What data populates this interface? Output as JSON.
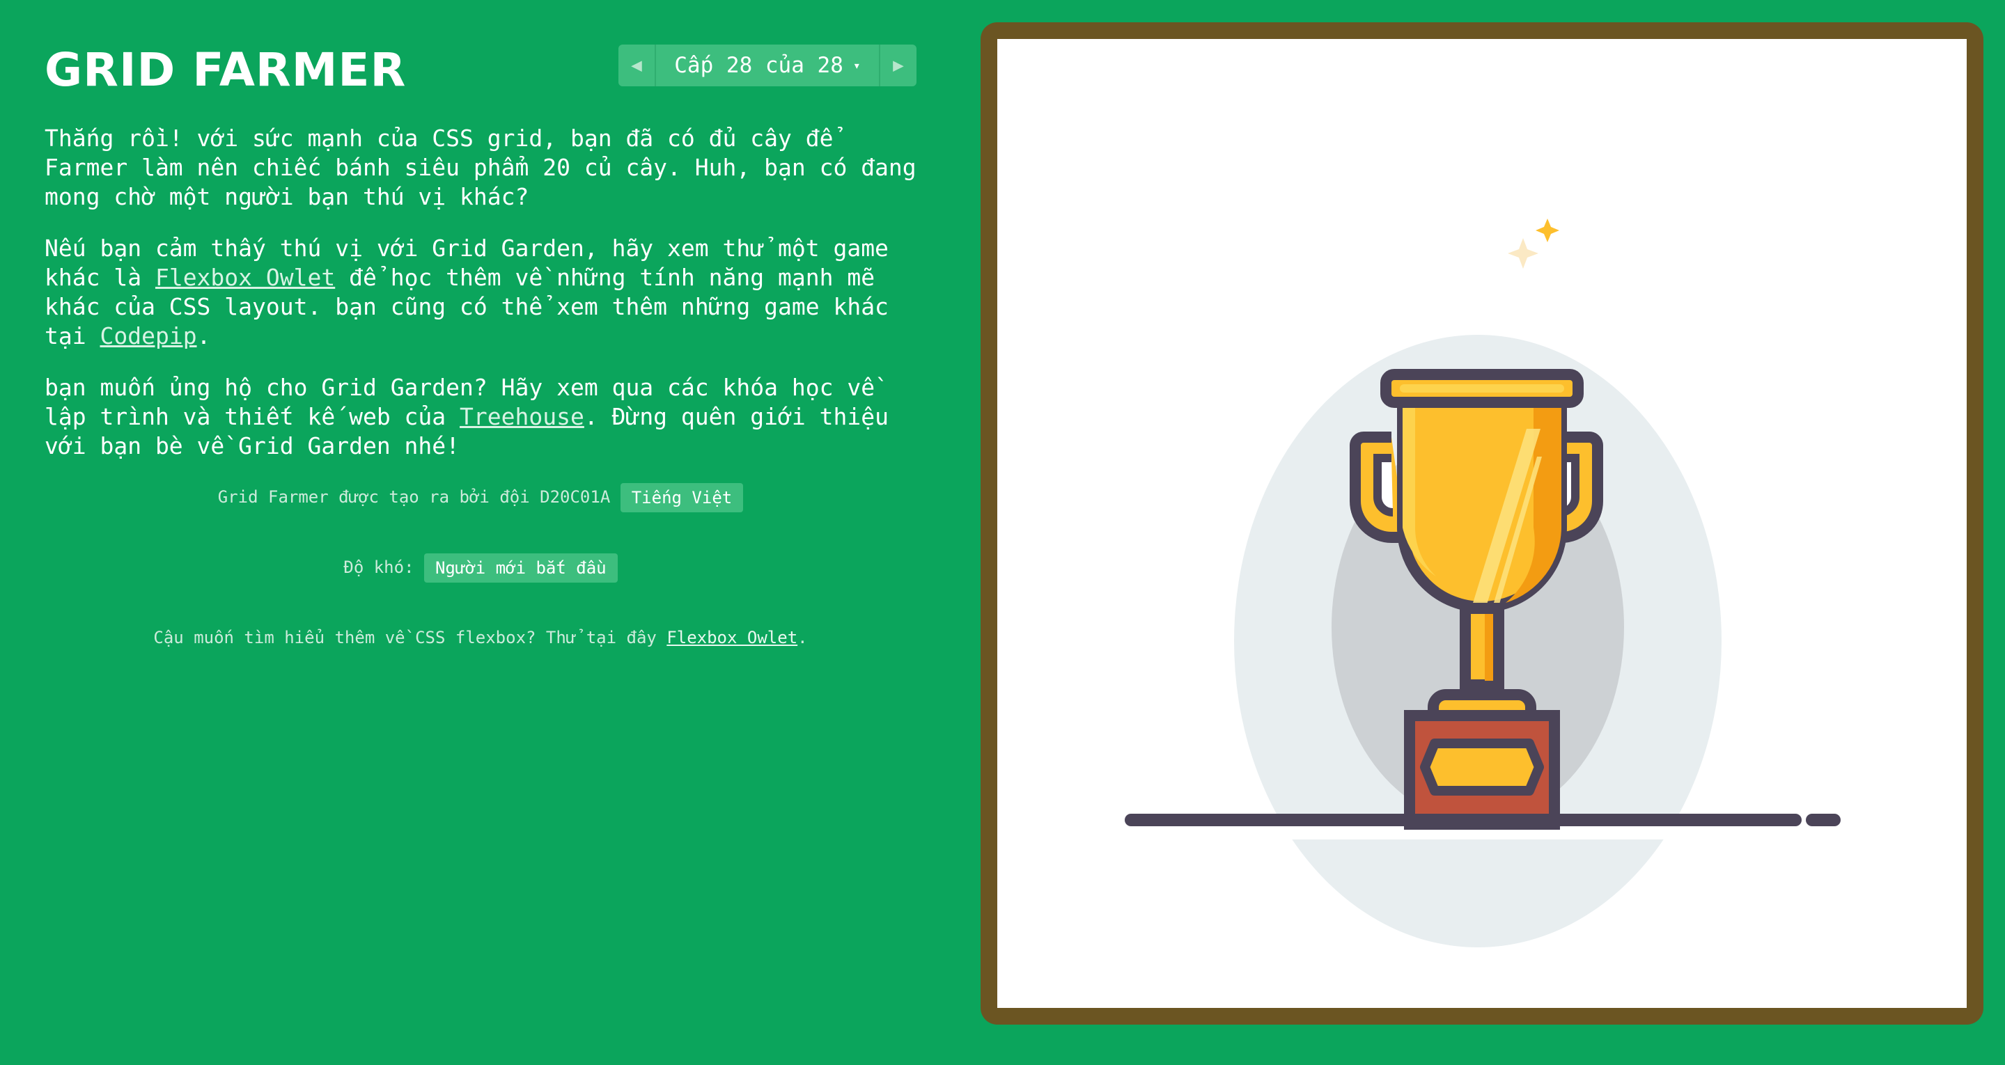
{
  "app": {
    "title": "GRID FARMER"
  },
  "level_nav": {
    "label": "Cấp 28 của 28",
    "caret": "▾",
    "prev_icon": "◀",
    "next_icon": "▶"
  },
  "instructions": {
    "p1": "Thắng rồi! với sức mạnh của CSS grid, bạn đã có đủ cây để Farmer làm nên chiếc bánh siêu phẩm 20 củ cây. Huh, bạn có đang mong chờ một người bạn thú vị khác?",
    "p2_before": "Nếu bạn cảm thấy thú vị với Grid Garden, hãy xem thử một game khác là ",
    "p2_link1": "Flexbox Owlet",
    "p2_middle": " để học thêm về những tính năng mạnh mẽ khác của CSS layout. bạn cũng có thể xem thêm những game khác tại ",
    "p2_link2": "Codepip",
    "p2_after": ".",
    "p3_before": "bạn muốn ủng hộ cho Grid Garden? Hãy xem qua các khóa học về lập trình và thiết kế web của ",
    "p3_link": "Treehouse",
    "p3_after": ". Đừng quên giới thiệu với bạn bè về Grid Garden nhé!"
  },
  "credits": {
    "text": "Grid Farmer được tạo ra bởi đội D20C01A",
    "language_button": "Tiếng Việt"
  },
  "difficulty": {
    "label": "Độ khó:",
    "value": "Người mới bắt đầu"
  },
  "promo": {
    "before": "Cậu muốn tìm hiểu thêm về CSS flexbox? Thử tại đây ",
    "link": "Flexbox Owlet",
    "after": "."
  },
  "board": {
    "frame_color": "#6b5522",
    "background_color": "#ffffff",
    "illustration": "trophy-icon"
  },
  "colors": {
    "page_background": "#0ba55c",
    "pill_background": "#3dbe7e",
    "trophy_gold": "#fdbf2d",
    "trophy_outline": "#4b4458",
    "plaque_red": "#c0533d"
  }
}
